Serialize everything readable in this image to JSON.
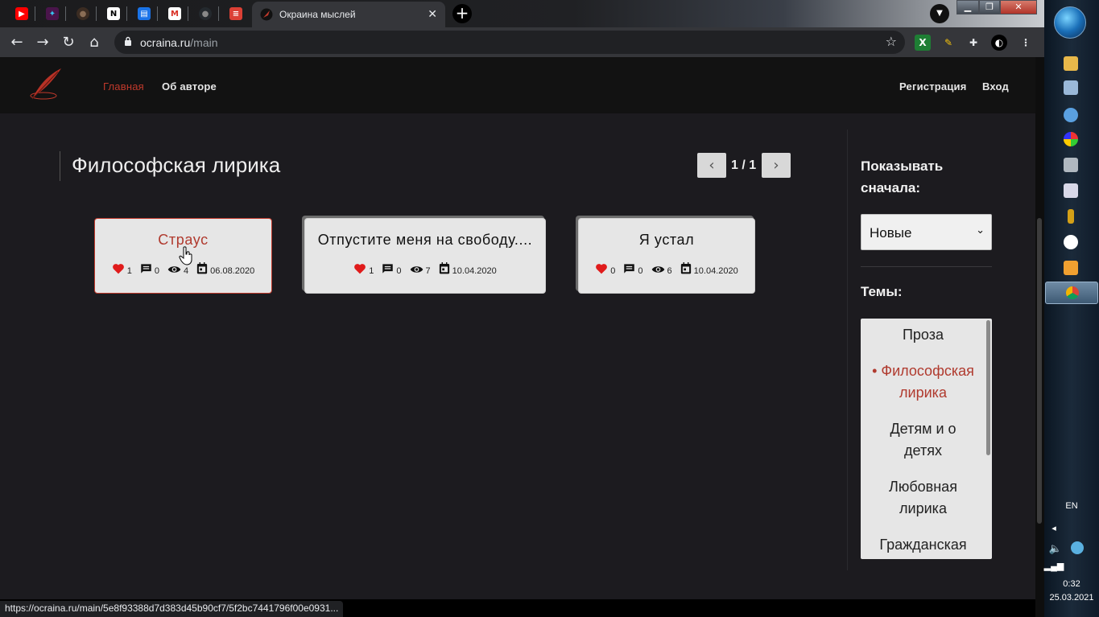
{
  "browser": {
    "pinned_tabs": [
      {
        "name": "youtube",
        "color": "#ff0000",
        "glyph": "▶"
      },
      {
        "name": "slack",
        "color": "#4a154b",
        "glyph": "✦"
      },
      {
        "name": "dark-app",
        "color": "#3b2c22",
        "glyph": "●"
      },
      {
        "name": "notion",
        "color": "#ffffff",
        "glyph": "N"
      },
      {
        "name": "chat",
        "color": "#1a73e8",
        "glyph": "▤"
      },
      {
        "name": "gmail",
        "color": "#ffffff",
        "glyph": "M"
      },
      {
        "name": "github",
        "color": "#24292e",
        "glyph": "●"
      },
      {
        "name": "todoist",
        "color": "#db4035",
        "glyph": "≡"
      }
    ],
    "active_tab": {
      "title": "Окраина мыслей",
      "close": "✕"
    },
    "new_tab": "+",
    "url_host": "ocraina.ru",
    "url_path": "/main",
    "status_url": "https://ocraina.ru/main/5e8f93388d7d383d45b90cf7/5f2bc7441796f00e0931..."
  },
  "site": {
    "nav": {
      "home": "Главная",
      "about": "Об авторе",
      "register": "Регистрация",
      "login": "Вход"
    },
    "heading": "Философская лирика",
    "pagination": {
      "text": "1 / 1",
      "prev": "‹",
      "next": "›"
    },
    "cards": [
      {
        "title": "Страус",
        "likes": "1",
        "comments": "0",
        "views": "4",
        "date": "06.08.2020"
      },
      {
        "title": "Отпустите меня на свободу....",
        "likes": "1",
        "comments": "0",
        "views": "7",
        "date": "10.04.2020"
      },
      {
        "title": "Я устал",
        "likes": "0",
        "comments": "0",
        "views": "6",
        "date": "10.04.2020"
      }
    ],
    "sidebar": {
      "sort_label": "Показывать сначала:",
      "sort_value": "Новые",
      "topics_label": "Темы:",
      "topics": [
        "Проза",
        "• Философская лирика",
        "Детям и о детях",
        "Любовная лирика",
        "Гражданская"
      ]
    }
  },
  "taskbar": {
    "lang": "EN",
    "time": "0:32",
    "date": "25.03.2021"
  },
  "colors": {
    "accent": "#c0392b",
    "page_bg": "#1c1b1f",
    "navbar_bg": "#121212",
    "card_bg": "#e6e6e6"
  }
}
